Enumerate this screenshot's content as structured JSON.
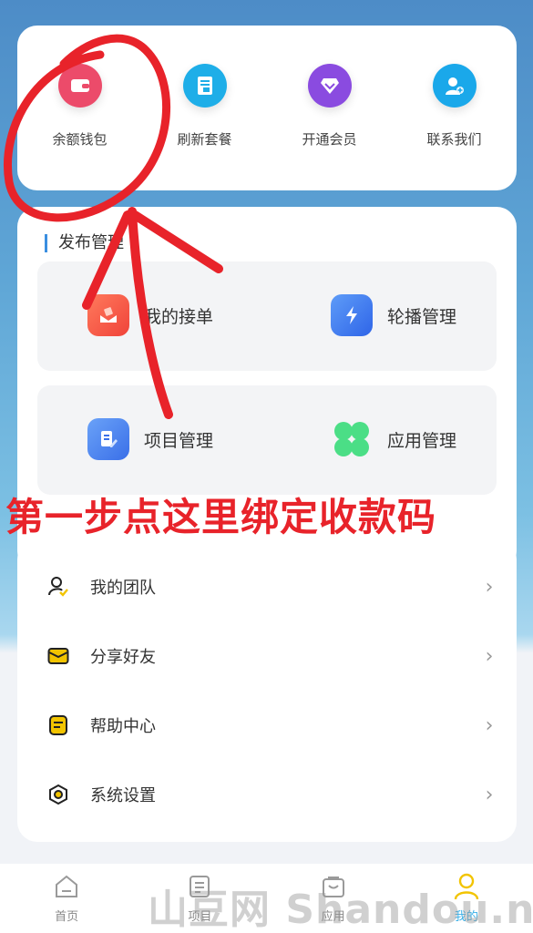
{
  "quick_actions": [
    {
      "label": "余额钱包",
      "icon": "wallet-icon",
      "color": "#ec4b6a"
    },
    {
      "label": "刷新套餐",
      "icon": "document-icon",
      "color": "#1eaee8"
    },
    {
      "label": "开通会员",
      "icon": "diamond-icon",
      "color": "#8a4be0"
    },
    {
      "label": "联系我们",
      "icon": "contact-icon",
      "color": "#1aa8ea"
    }
  ],
  "publish": {
    "title": "发布管理",
    "items": [
      {
        "label": "我的接单",
        "icon": "order-icon",
        "color": "#f25a4a"
      },
      {
        "label": "轮播管理",
        "icon": "lightning-icon",
        "color": "#3f7cf0"
      },
      {
        "label": "项目管理",
        "icon": "edit-icon",
        "color": "#4b86f0"
      },
      {
        "label": "应用管理",
        "icon": "clover-icon",
        "color": "#3ed47a"
      }
    ]
  },
  "annotation": "第一步点这里绑定收款码",
  "menu": [
    {
      "label": "我的团队",
      "icon": "team-icon"
    },
    {
      "label": "分享好友",
      "icon": "mail-icon"
    },
    {
      "label": "帮助中心",
      "icon": "help-icon"
    },
    {
      "label": "系统设置",
      "icon": "settings-icon"
    }
  ],
  "tabbar": [
    {
      "label": "首页",
      "icon": "home-icon"
    },
    {
      "label": "项目",
      "icon": "project-icon"
    },
    {
      "label": "应用",
      "icon": "app-icon"
    },
    {
      "label": "我的",
      "icon": "user-icon",
      "active": true
    }
  ],
  "watermark": "山豆网 Shandou.net",
  "colors": {
    "accent": "#3ab0e8",
    "annotation_red": "#e8232a",
    "highlight": "#f2c400"
  }
}
